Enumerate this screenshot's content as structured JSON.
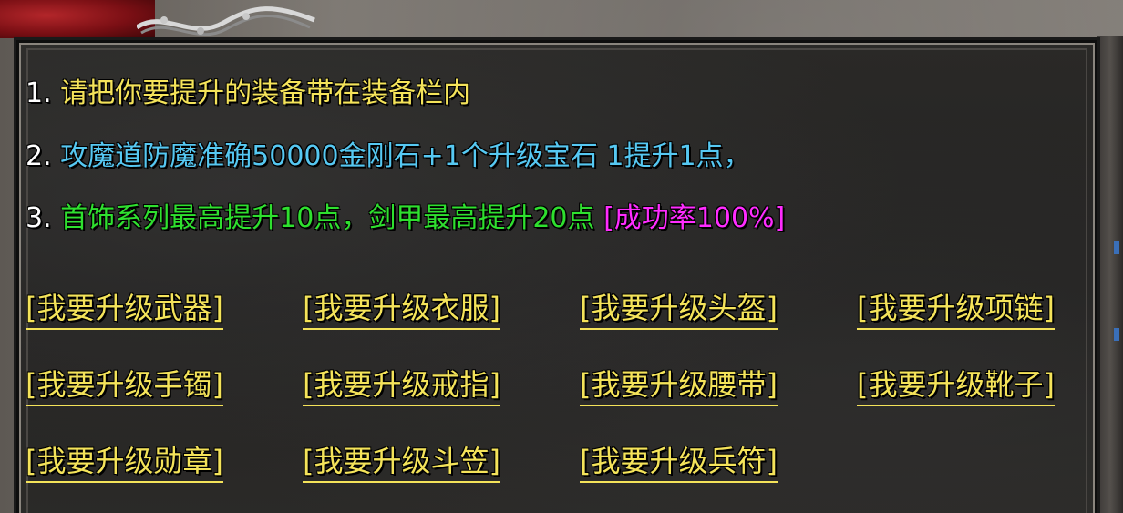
{
  "instructions": {
    "line1": {
      "num": "1.",
      "text": "请把你要提升的装备带在装备栏内"
    },
    "line2": {
      "num": "2.",
      "text": "攻魔道防魔准确50000金刚石+1个升级宝石 1提升1点，"
    },
    "line3": {
      "num": "3.",
      "text": "首饰系列最高提升10点，剑甲最高提升20点",
      "rate": "[成功率100%]"
    }
  },
  "options": [
    {
      "label": "[我要升级武器]"
    },
    {
      "label": "[我要升级衣服]"
    },
    {
      "label": "[我要升级头盔]"
    },
    {
      "label": "[我要升级项链]"
    },
    {
      "label": "[我要升级手镯]"
    },
    {
      "label": "[我要升级戒指]"
    },
    {
      "label": "[我要升级腰带]"
    },
    {
      "label": "[我要升级靴子]"
    },
    {
      "label": "[我要升级勋章]"
    },
    {
      "label": "[我要升级斗笠]"
    },
    {
      "label": "[我要升级兵符]"
    }
  ],
  "colors": {
    "yellow": "#f4e35a",
    "cyan": "#56c8f2",
    "green": "#2fe02f",
    "magenta": "#ff2cff",
    "panel": "#262523"
  }
}
